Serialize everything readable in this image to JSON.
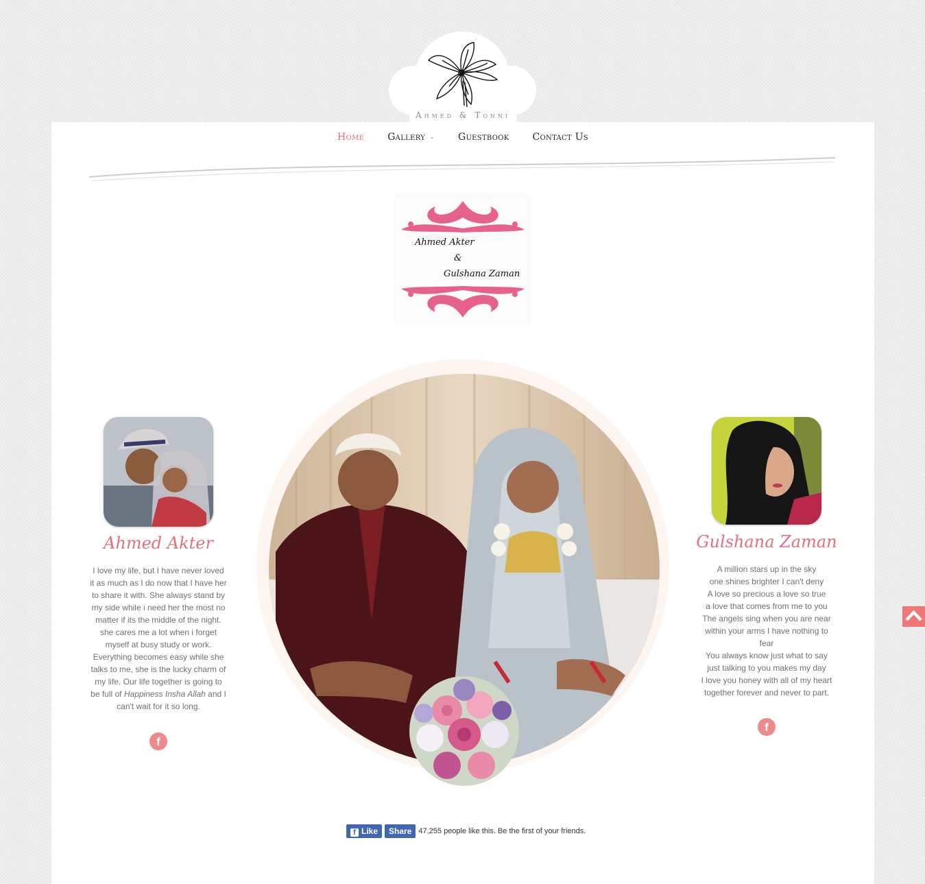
{
  "brand": {
    "logo_text": "Ahmed & Tonni"
  },
  "nav": {
    "items": [
      {
        "label": "Home",
        "active": true
      },
      {
        "label": "Gallery",
        "has_submenu": true
      },
      {
        "label": "Guestbook"
      },
      {
        "label": "Contact Us"
      }
    ]
  },
  "monogram": {
    "line1": "Ahmed Akter",
    "line2": "&",
    "line3": "Gulshana Zaman"
  },
  "groom": {
    "name": "Ahmed Akter",
    "bio_part1": "I love my life, but I have never loved it as much as I do now that I have her to share it with. She always stand by my side while i need her the most no matter if its the middle of the night. she cares me a lot when i forget myself at busy study or work. Everything becomes easy while she talks to me, she is the lucky charm of my life.  Our life together is going to be full of",
    "bio_italic": "Happiness Insha Allah",
    "bio_part2": " and I can't wait for it so long.",
    "social_icon": "facebook-icon"
  },
  "bride": {
    "name": "Gulshana Zaman",
    "poem": [
      "A million stars up in the sky",
      "one shines brighter I can't deny",
      "A love so precious a love so true",
      "a love that comes from me to you",
      "The angels sing when you are near",
      "within your arms I have nothing to fear",
      "You always know just what to say",
      "just talking to you makes my day",
      "I love you honey with all of my heart",
      "together forever and never to part."
    ],
    "social_icon": "facebook-icon"
  },
  "facebook": {
    "like_label": "Like",
    "share_label": "Share",
    "like_text": "47,255 people like this. Be the first of your friends."
  },
  "colors": {
    "accent": "#e36f7f",
    "fb_blue": "#4267b2",
    "scroll_top": "#ee7878"
  }
}
